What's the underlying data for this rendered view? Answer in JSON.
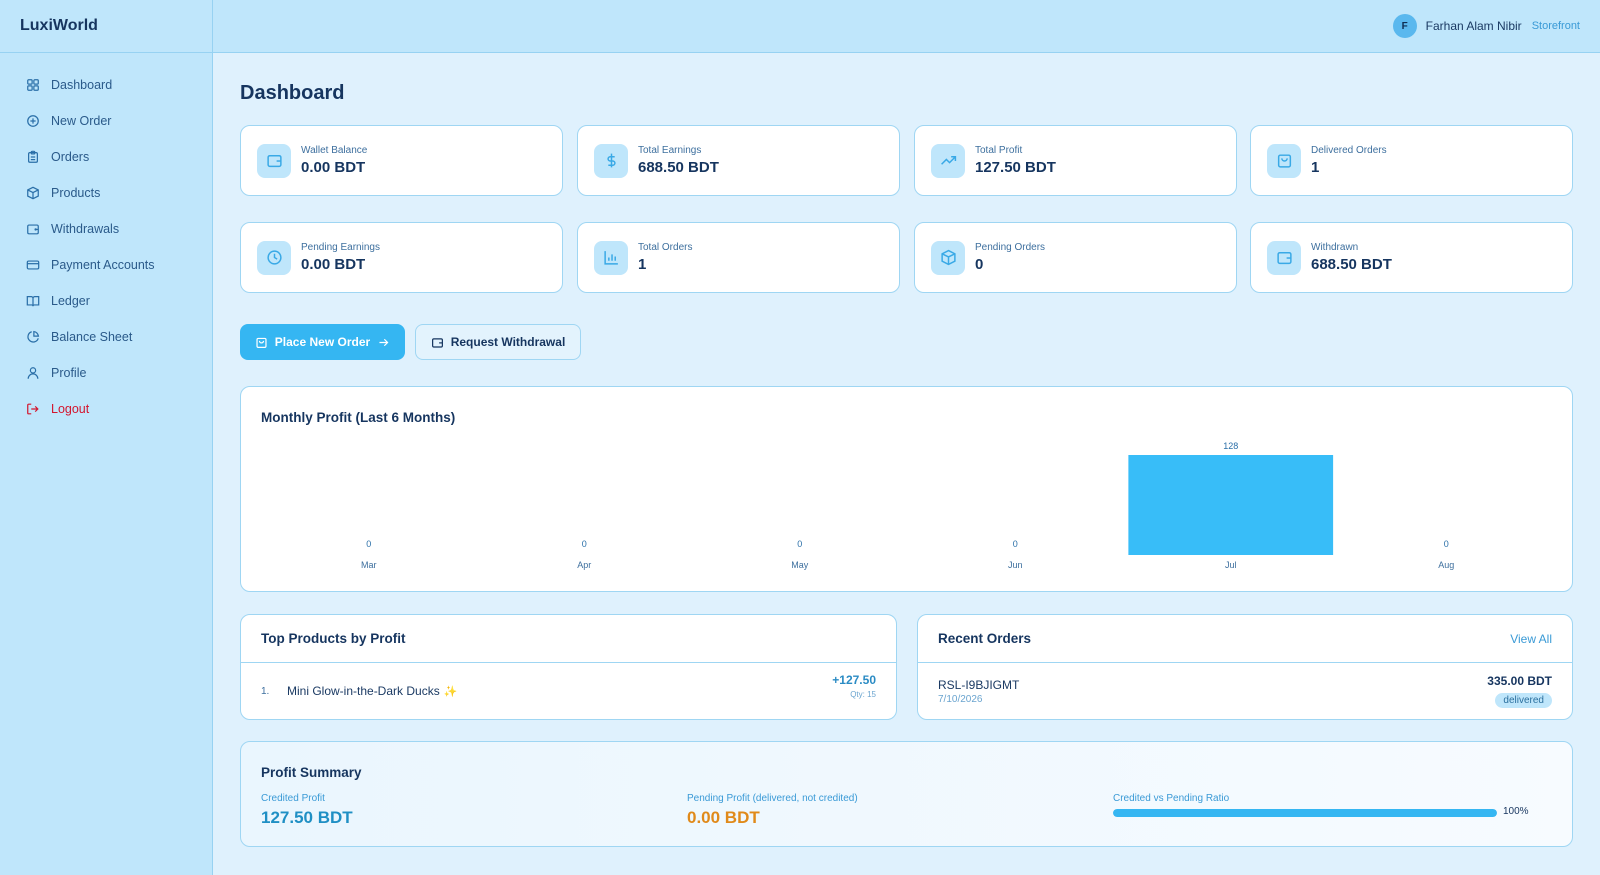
{
  "brand": "LuxiWorld",
  "sidebar": {
    "items": [
      {
        "label": "Dashboard",
        "icon": "grid-icon"
      },
      {
        "label": "New Order",
        "icon": "plus-circle-icon"
      },
      {
        "label": "Orders",
        "icon": "clipboard-icon"
      },
      {
        "label": "Products",
        "icon": "box-icon"
      },
      {
        "label": "Withdrawals",
        "icon": "wallet-icon"
      },
      {
        "label": "Payment Accounts",
        "icon": "credit-card-icon"
      },
      {
        "label": "Ledger",
        "icon": "book-icon"
      },
      {
        "label": "Balance Sheet",
        "icon": "pie-icon"
      },
      {
        "label": "Profile",
        "icon": "user-icon"
      },
      {
        "label": "Logout",
        "icon": "logout-icon"
      }
    ]
  },
  "header": {
    "avatar_initial": "F",
    "user_name": "Farhan Alam Nibir",
    "storefront_link": "Storefront"
  },
  "page": {
    "title": "Dashboard"
  },
  "stats": [
    {
      "label": "Wallet Balance",
      "value": "0.00 BDT",
      "icon": "wallet-icon"
    },
    {
      "label": "Total Earnings",
      "value": "688.50 BDT",
      "icon": "dollar-icon"
    },
    {
      "label": "Total Profit",
      "value": "127.50 BDT",
      "icon": "trend-up-icon"
    },
    {
      "label": "Delivered Orders",
      "value": "1",
      "icon": "bag-icon"
    },
    {
      "label": "Pending Earnings",
      "value": "0.00 BDT",
      "icon": "clock-icon"
    },
    {
      "label": "Total Orders",
      "value": "1",
      "icon": "bar-chart-icon"
    },
    {
      "label": "Pending Orders",
      "value": "0",
      "icon": "box-icon"
    },
    {
      "label": "Withdrawn",
      "value": "688.50 BDT",
      "icon": "wallet-icon"
    }
  ],
  "actions": {
    "place_order": "Place New Order",
    "request_withdrawal": "Request Withdrawal"
  },
  "chart_data": {
    "type": "bar",
    "title": "Monthly Profit (Last 6 Months)",
    "categories": [
      "Mar",
      "Apr",
      "May",
      "Jun",
      "Jul",
      "Aug"
    ],
    "values": [
      0,
      0,
      0,
      0,
      128,
      0
    ],
    "value_labels": [
      "0",
      "0",
      "0",
      "0",
      "128",
      "0"
    ],
    "ylim": [
      0,
      128
    ],
    "grid": false,
    "color": "#38bdf8"
  },
  "top_products": {
    "title": "Top Products by Profit",
    "items": [
      {
        "rank": "1.",
        "name": "Mini Glow-in-the-Dark Ducks",
        "sparkle": "✨",
        "profit": "+127.50",
        "qty": "Qty: 15"
      }
    ]
  },
  "recent_orders": {
    "title": "Recent Orders",
    "view_all": "View All",
    "items": [
      {
        "id": "RSL-I9BJIGMT",
        "date": "7/10/2026",
        "amount": "335.00 BDT",
        "status": "delivered"
      }
    ]
  },
  "profit_summary": {
    "title": "Profit Summary",
    "credited_label": "Credited Profit",
    "credited_value": "127.50 BDT",
    "pending_label": "Pending Profit (delivered, not credited)",
    "pending_value": "0.00 BDT",
    "ratio_label": "Credited vs Pending Ratio",
    "ratio_percent": "100%",
    "ratio_fraction": 1.0
  },
  "colors": {
    "accent": "#35b6f2",
    "sidebar_bg": "#bfe6fb",
    "page_bg": "#dff1fd",
    "logout": "#d3162e",
    "pending_profit": "#e08a1a"
  }
}
